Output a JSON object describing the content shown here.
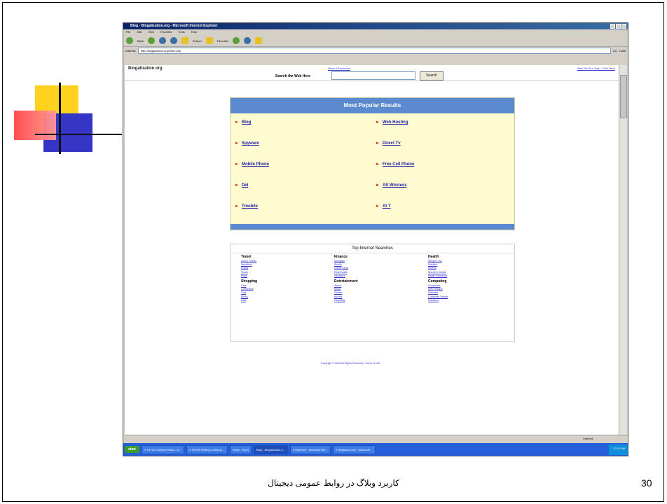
{
  "slide": {
    "caption": "کاربرد وبلاگ در روابط عمومی دیجیتال",
    "page_number": "30"
  },
  "browser": {
    "title": "Blog - Blogalization.org - Microsoft Internet Explorer",
    "menu": [
      "File",
      "Edit",
      "View",
      "Favorites",
      "Tools",
      "Help"
    ],
    "toolbar": {
      "back": "Back",
      "search": "Search",
      "favorites": "Favorites"
    },
    "address_label": "Address",
    "address": "http://blogalization.org/index.php",
    "go": "Go",
    "links": "Links"
  },
  "site": {
    "name": "Blogalization.org",
    "header_links": "Home | Bookmark",
    "header_right": "Web Site For Sale - Click Here",
    "search_label": "Search the Web Here",
    "search_button": "Search"
  },
  "popular": {
    "heading": "Most Popular Results",
    "left": [
      "Blog",
      "Spyware",
      "Mobile Phone",
      "Del",
      "Tmobile"
    ],
    "right": [
      "Web Hosting",
      "Direct Tv",
      "Free Cell Phone",
      "Att Wireless",
      "At T"
    ]
  },
  "top_searches": {
    "title": "Top Internet Searches",
    "columns": [
      {
        "sections": [
          {
            "head": "Travel",
            "links": [
              "Airline Tickets",
              "Vacations",
              "Hotels",
              "Travel",
              "Maps"
            ]
          },
          {
            "head": "Shopping",
            "links": [
              "Cars",
              "Computers",
              "Toys",
              "Books",
              "Gifts"
            ]
          }
        ]
      },
      {
        "sections": [
          {
            "head": "Finance",
            "links": [
              "Mortgage",
              "Stocks",
              "Credit Cards",
              "Real Estate",
              "Insurance"
            ]
          },
          {
            "head": "Entertainment",
            "links": [
              "Sports",
              "Music",
              "Games",
              "Movies",
              "Gambling"
            ]
          }
        ]
      },
      {
        "sections": [
          {
            "head": "Health",
            "links": [
              "Weight Loss",
              "Nutrition",
              "Fitness",
              "Women's Health",
              "Health Insurance"
            ]
          },
          {
            "head": "Computing",
            "links": [
              "Computers",
              "Web Hosting",
              "Software",
              "Computer Games",
              "Hardware"
            ]
          }
        ]
      }
    ]
  },
  "footer": {
    "copyright": "Copyright © 2005 All Rights Reserved | Terms of Use"
  },
  "statusbar": {
    "zone": "Internet"
  },
  "taskbar": {
    "start": "start",
    "tasks": [
      "3 TNTLB Campus News - M...",
      "2 TNTLB Weblog Campus ...",
      "Inbox - Eport",
      "Blog - Blogalization.o...",
      "3 Delphine - Microsoft Inte...",
      "2 Blogsurm.com - Microsoft ..."
    ],
    "active_index": 3,
    "clock": "10:21 AM"
  }
}
